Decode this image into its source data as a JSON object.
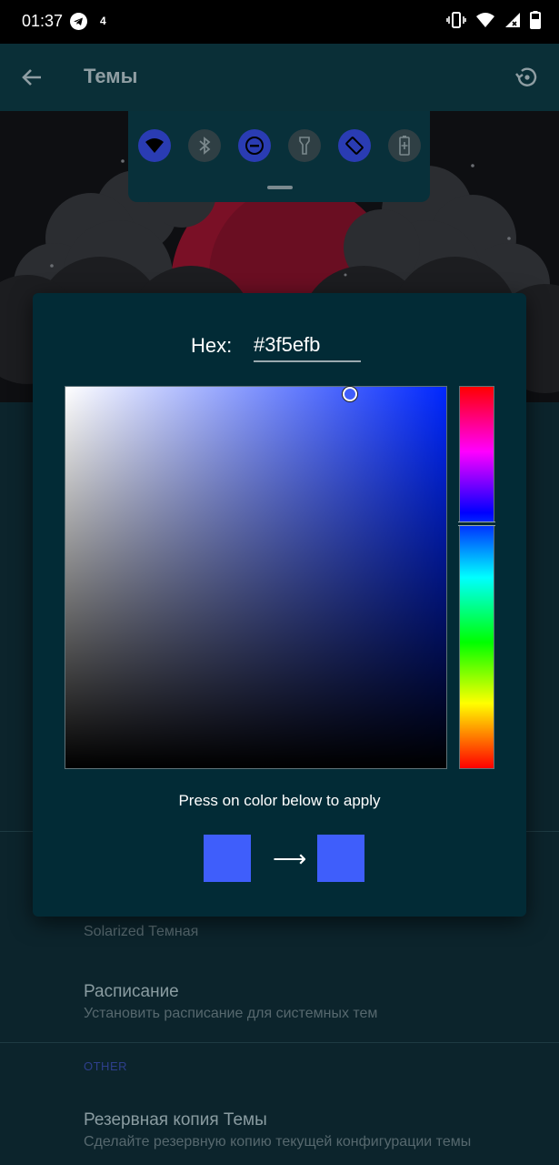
{
  "status_bar": {
    "time": "01:37",
    "notification_count": "4"
  },
  "app_bar": {
    "title": "Темы",
    "back_icon": "arrow-back-icon",
    "restore_icon": "restore-icon"
  },
  "quick_settings": {
    "tiles": [
      {
        "icon": "wifi-icon",
        "active": true
      },
      {
        "icon": "bluetooth-icon",
        "active": false
      },
      {
        "icon": "dnd-icon",
        "active": true
      },
      {
        "icon": "flashlight-icon",
        "active": false
      },
      {
        "icon": "auto-rotate-icon",
        "active": true
      },
      {
        "icon": "battery-saver-icon",
        "active": false
      }
    ]
  },
  "background_list": {
    "current_theme": "Solarized Темная",
    "schedule": {
      "title": "Расписание",
      "subtitle": "Установить расписание для системных тем"
    },
    "section_other": "OTHER",
    "backup": {
      "title": "Резервная копия Темы",
      "subtitle": "Сделайте резервную копию текущей конфигурации темы"
    }
  },
  "color_picker": {
    "hex_label": "Hex:",
    "hex_value": "#3f5efb",
    "hint": "Press on color below to apply",
    "arrow": "⟶",
    "old_color": "#3f5efb",
    "new_color": "#3f5efb"
  },
  "colors": {
    "accent": "#3f5efb",
    "dialog_bg": "#022b36",
    "app_bar_bg": "#0a2f37"
  }
}
